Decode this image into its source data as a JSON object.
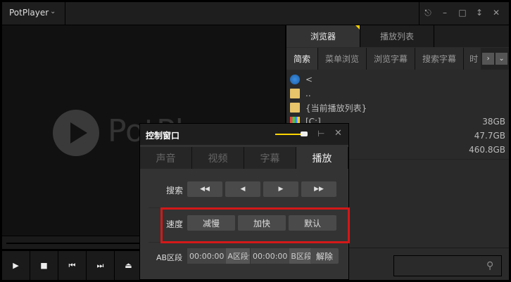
{
  "titlebar": {
    "app_name": "PotPlayer",
    "menu_icon": "chevron-down-icon"
  },
  "video": {
    "logo_text": "PotPl"
  },
  "controls": [
    "play-icon",
    "stop-icon",
    "previous-icon",
    "next-icon",
    "eject-icon"
  ],
  "panel": {
    "tabs": [
      "浏览器",
      "播放列表"
    ],
    "subtabs": [
      "简索",
      "菜单浏览",
      "浏览字幕",
      "搜索字幕",
      "时"
    ],
    "files": [
      {
        "name": "<",
        "size": ""
      },
      {
        "name": "..",
        "size": ""
      },
      {
        "name": "{当前播放列表}",
        "size": ""
      },
      {
        "name": "[C:]",
        "size": "38GB"
      },
      {
        "name": "",
        "size": "47.7GB"
      },
      {
        "name": "",
        "size": "460.8GB"
      }
    ],
    "search_value": ""
  },
  "control_window": {
    "title": "控制窗口",
    "tabs": [
      "声音",
      "视频",
      "字幕",
      "播放"
    ],
    "search_label": "搜索",
    "speed_label": "速度",
    "speed_buttons": [
      "减慢",
      "加快",
      "默认"
    ],
    "ab_label": "AB区段",
    "a_time": "00:00:00",
    "a_label": "A区段",
    "tilde": "~",
    "b_time": "00:00:00",
    "b_label": "B区段",
    "clear_label": "解除"
  },
  "colors": {
    "accent": "#ffd400",
    "highlight": "#d41818"
  }
}
